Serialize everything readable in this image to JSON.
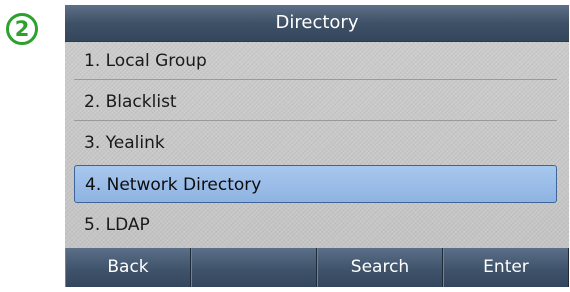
{
  "step_badge": "2",
  "title": "Directory",
  "menu": {
    "items": [
      {
        "label": "1. Local Group",
        "selected": false
      },
      {
        "label": "2. Blacklist",
        "selected": false
      },
      {
        "label": "3. Yealink",
        "selected": false
      },
      {
        "label": "4. Network Directory",
        "selected": true
      },
      {
        "label": "5. LDAP",
        "selected": false
      }
    ]
  },
  "softkeys": {
    "back": "Back",
    "blank": "",
    "search": "Search",
    "enter": "Enter"
  },
  "colors": {
    "badge": "#2aa22c",
    "title_bar": "#3f5167",
    "selection": "#9dbfe9",
    "softkey": "#3f536b"
  }
}
